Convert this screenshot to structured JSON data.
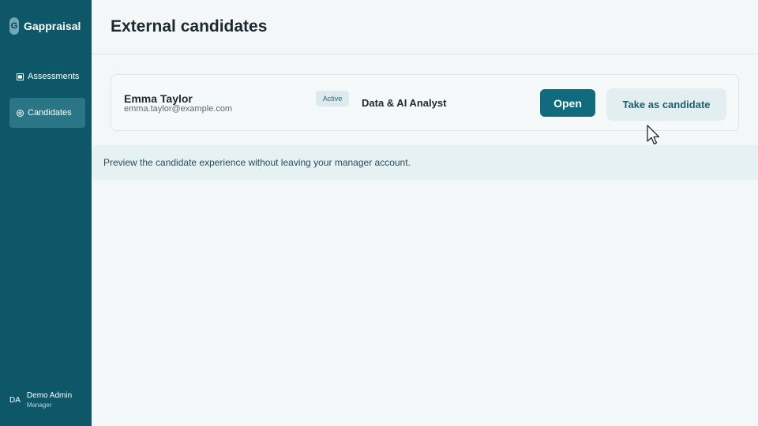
{
  "brand": {
    "logo_letter": "G",
    "name": "Gappraisal"
  },
  "sidebar": {
    "items": [
      {
        "label": "Assessments",
        "icon": "clipboard-icon",
        "active": false
      },
      {
        "label": "Candidates",
        "icon": "user-circle-icon",
        "active": true
      }
    ]
  },
  "user": {
    "initials": "DA",
    "name": "Demo Admin",
    "role": "Manager"
  },
  "header": {
    "title": "External candidates"
  },
  "candidates": [
    {
      "name": "Emma Taylor",
      "email": "emma.taylor@example.com",
      "status": "Active",
      "role": "Data & AI Analyst",
      "open_label": "Open",
      "take_label": "Take as candidate"
    }
  ],
  "info": {
    "text": "Preview the candidate experience without leaving your manager account."
  },
  "colors": {
    "sidebar": "#0d5768",
    "accent": "#0f6b7d",
    "active_nav": "#2b7686",
    "background": "#f4f7f8"
  }
}
